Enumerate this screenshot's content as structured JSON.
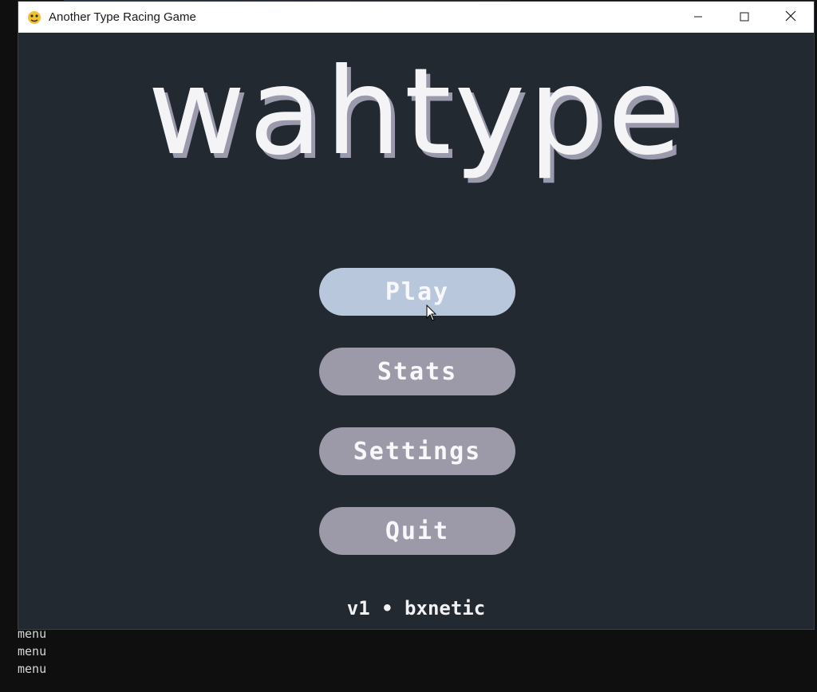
{
  "window": {
    "title": "Another Type Racing Game",
    "icons": {
      "app": "pygame-snake-icon",
      "minimize": "minimize-icon",
      "maximize": "maximize-icon",
      "close": "close-icon"
    }
  },
  "game": {
    "logo": "wahtype",
    "menu": {
      "play_label": "Play",
      "stats_label": "Stats",
      "settings_label": "Settings",
      "quit_label": "Quit",
      "hovered": "Play"
    },
    "footer": "v1 • bxnetic"
  },
  "console": {
    "lines": [
      "menu",
      "menu",
      "menu"
    ]
  },
  "colors": {
    "window_bg": "#222931",
    "button": "#9c9aa8",
    "button_hover": "#b8c7dc",
    "logo": "#f4f4f6",
    "logo_shadow": "#9a9aac"
  }
}
